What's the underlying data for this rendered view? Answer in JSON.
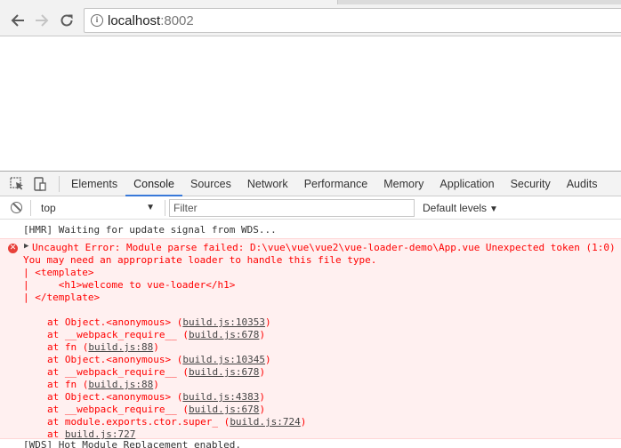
{
  "browser": {
    "url_host": "localhost",
    "url_port": ":8002"
  },
  "devtools": {
    "tabs": [
      "Elements",
      "Console",
      "Sources",
      "Network",
      "Performance",
      "Memory",
      "Application",
      "Security",
      "Audits"
    ],
    "active_tab": "Console",
    "context": "top",
    "filter_placeholder": "Filter",
    "levels": "Default levels"
  },
  "console": {
    "log": "[HMR] Waiting for update signal from WDS...",
    "error": {
      "message": "Uncaught Error: Module parse failed: D:\\vue\\vue\\vue2\\vue-loader-demo\\App.vue Unexpected token (1:0)",
      "lines": [
        "You may need an appropriate loader to handle this file type.",
        "| <template>",
        "|     <h1>welcome to vue-loader</h1>",
        "| </template>",
        ""
      ],
      "stack": [
        {
          "fn": "at Object.<anonymous> (",
          "link": "build.js:10353",
          "tail": ")"
        },
        {
          "fn": "at __webpack_require__ (",
          "link": "build.js:678",
          "tail": ")"
        },
        {
          "fn": "at fn (",
          "link": "build.js:88",
          "tail": ")"
        },
        {
          "fn": "at Object.<anonymous> (",
          "link": "build.js:10345",
          "tail": ")"
        },
        {
          "fn": "at __webpack_require__ (",
          "link": "build.js:678",
          "tail": ")"
        },
        {
          "fn": "at fn (",
          "link": "build.js:88",
          "tail": ")"
        },
        {
          "fn": "at Object.<anonymous> (",
          "link": "build.js:4383",
          "tail": ")"
        },
        {
          "fn": "at __webpack_require__ (",
          "link": "build.js:678",
          "tail": ")"
        },
        {
          "fn": "at module.exports.ctor.super_ (",
          "link": "build.js:724",
          "tail": ")"
        },
        {
          "fn": "at ",
          "link": "build.js:727",
          "tail": ""
        }
      ]
    },
    "cut_line": "[WDS] Hot Module Replacement enabled."
  }
}
